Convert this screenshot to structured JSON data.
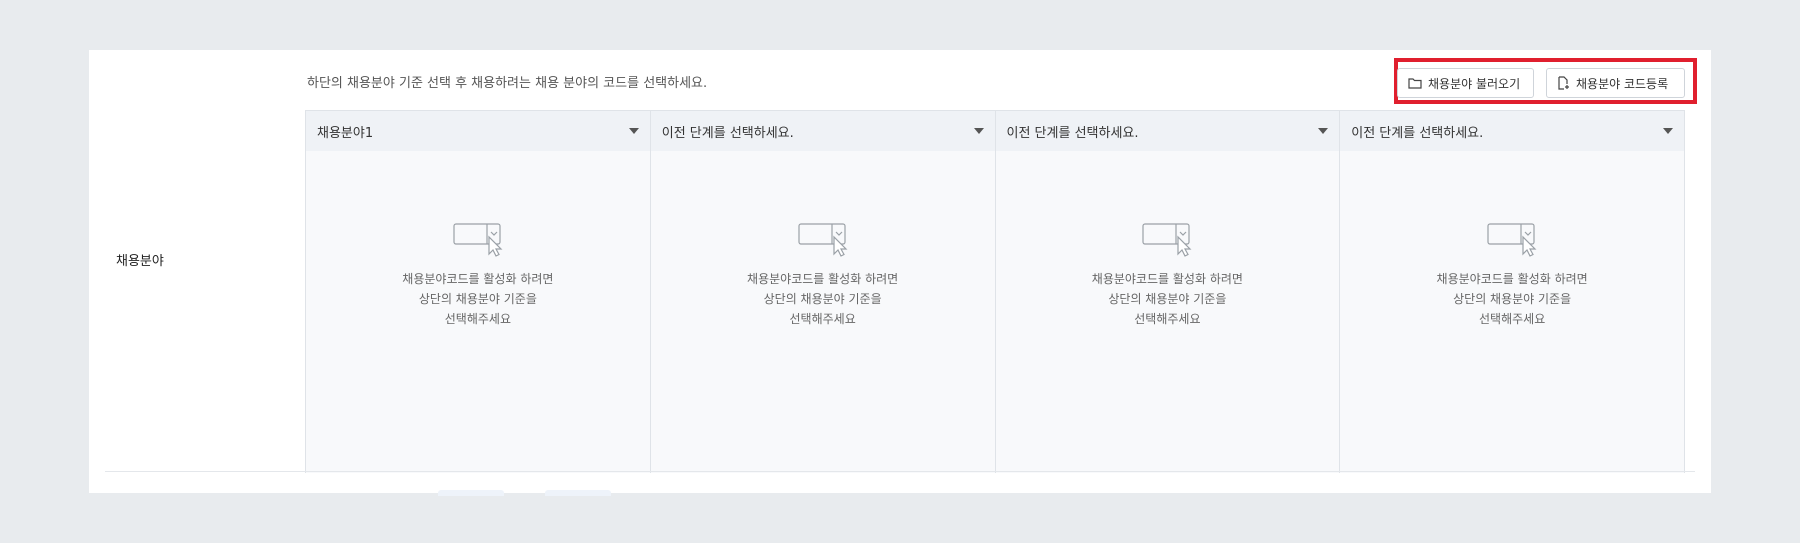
{
  "form": {
    "row_label": "채용분야",
    "hint": "하단의 채용분야 기준 선택 후 채용하려는 채용 분야의 코드를 선택하세요."
  },
  "toolbar": {
    "load_label": "채용분야 불러오기",
    "register_label": "채용분야 코드등록",
    "load_icon": "folder-icon",
    "register_icon": "file-add-icon"
  },
  "columns": [
    {
      "selected": "채용분야1"
    },
    {
      "selected": "이전 단계를 선택하세요."
    },
    {
      "selected": "이전 단계를 선택하세요."
    },
    {
      "selected": "이전 단계를 선택하세요."
    }
  ],
  "empty_state": {
    "line1": "채용분야코드를 활성화 하려면",
    "line2": "상단의 채용분야 기준을",
    "line3": "선택해주세요"
  },
  "colors": {
    "highlight": "#e01f2e",
    "background": "#e8ebee"
  }
}
